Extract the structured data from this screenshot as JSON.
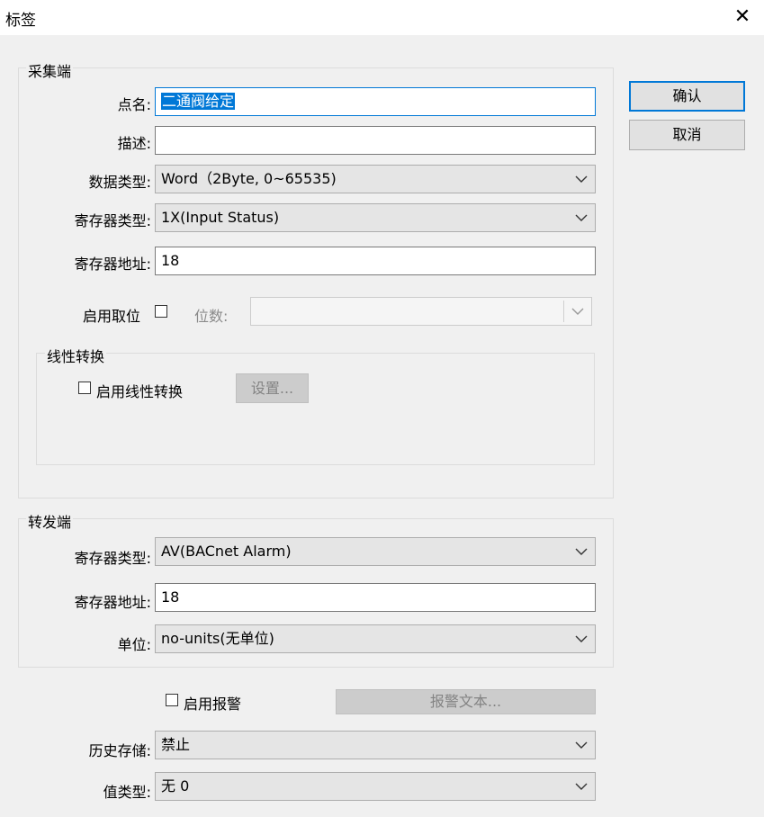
{
  "window": {
    "title": "标签"
  },
  "buttons": {
    "ok": "确认",
    "cancel": "取消"
  },
  "collect": {
    "legend": "采集端",
    "point_name_label": "点名:",
    "point_name_value": "二通阀给定",
    "desc_label": "描述:",
    "desc_value": "",
    "data_type_label": "数据类型:",
    "data_type_value": "Word（2Byte, 0~65535)",
    "reg_type_label": "寄存器类型:",
    "reg_type_value": "1X(Input Status)",
    "reg_addr_label": "寄存器地址:",
    "reg_addr_value": "18",
    "enable_bit_label": "启用取位",
    "bits_label": "位数:",
    "bits_value": "",
    "linear": {
      "legend": "线性转换",
      "enable_label": "启用线性转换",
      "settings_button": "设置..."
    }
  },
  "forward": {
    "legend": "转发端",
    "reg_type_label": "寄存器类型:",
    "reg_type_value": "AV(BACnet Alarm)",
    "reg_addr_label": "寄存器地址:",
    "reg_addr_value": "18",
    "unit_label": "单位:",
    "unit_value": "no-units(无单位)"
  },
  "alarm": {
    "enable_label": "启用报警",
    "text_button": "报警文本..."
  },
  "history": {
    "label": "历史存储:",
    "value": "禁止"
  },
  "value_type": {
    "label": "值类型:",
    "value": "无 0"
  }
}
